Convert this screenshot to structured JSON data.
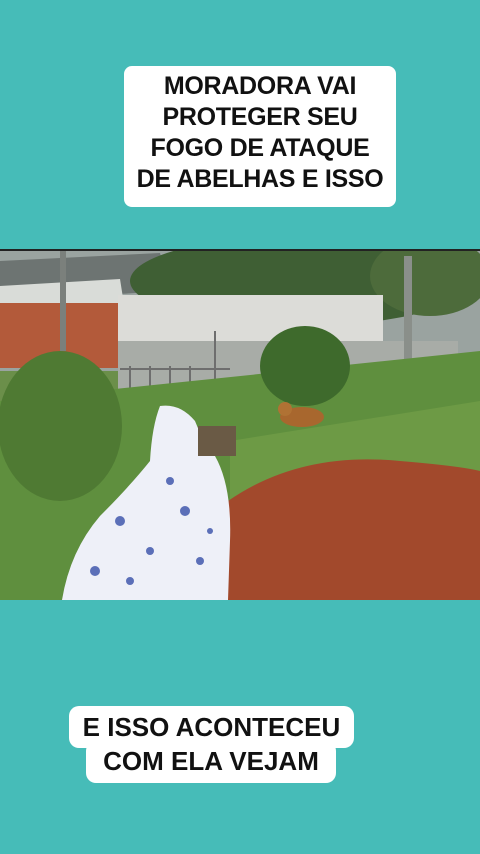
{
  "captions": {
    "top_lines": [
      "MORADORA VAI",
      "PROTEGER SEU",
      "FOGO DE ATAQUE",
      "DE ABELHAS E ISSO"
    ],
    "bottom_line_1": "E ISSO ACONTECEU",
    "bottom_line_2": "COM ELA VEJAM"
  },
  "colors": {
    "background": "#46bcb8",
    "caption_bg": "#ffffff",
    "caption_text": "#111111"
  }
}
